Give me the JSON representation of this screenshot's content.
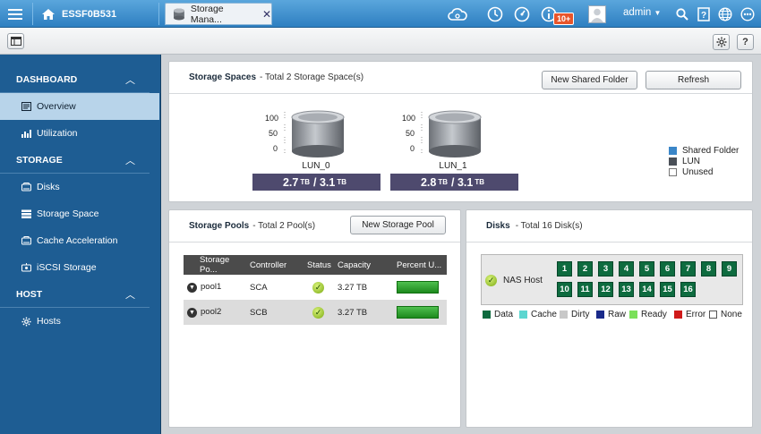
{
  "header": {
    "hostname": "ESSF0B531",
    "app_tab": "Storage Mana...",
    "notification_count": "10+",
    "user": "admin"
  },
  "sidebar": {
    "sections": [
      {
        "label": "DASHBOARD",
        "items": [
          "Overview",
          "Utilization"
        ]
      },
      {
        "label": "STORAGE",
        "items": [
          "Disks",
          "Storage Space",
          "Cache Acceleration",
          "iSCSI Storage"
        ]
      },
      {
        "label": "HOST",
        "items": [
          "Hosts"
        ]
      }
    ],
    "active_item": "Overview"
  },
  "storage_spaces": {
    "title": "Storage Spaces",
    "subtitle": "- Total 2 Storage Space(s)",
    "new_folder_label": "New Shared Folder",
    "refresh_label": "Refresh",
    "y_ticks": [
      "100",
      "50",
      "0"
    ],
    "luns": [
      {
        "name": "LUN_0",
        "used": "2.7",
        "unit1": "TB",
        "sep": "/",
        "total": "3.1",
        "unit2": "TB"
      },
      {
        "name": "LUN_1",
        "used": "2.8",
        "unit1": "TB",
        "sep": "/",
        "total": "3.1",
        "unit2": "TB"
      }
    ],
    "legend": [
      {
        "label": "Shared Folder",
        "color": "#3a86c8"
      },
      {
        "label": "LUN",
        "color": "#4a5058"
      },
      {
        "label": "Unused",
        "color": "#ffffff"
      }
    ]
  },
  "storage_pools": {
    "title": "Storage Pools",
    "subtitle": "- Total 2 Pool(s)",
    "new_pool_label": "New Storage Pool",
    "columns": [
      "Storage Po...",
      "Controller",
      "Status",
      "Capacity",
      "Percent U..."
    ],
    "rows": [
      {
        "name": "pool1",
        "controller": "SCA",
        "capacity": "3.27 TB",
        "percent_used": 1.0
      },
      {
        "name": "pool2",
        "controller": "SCB",
        "capacity": "3.27 TB",
        "percent_used": 1.0
      }
    ]
  },
  "disks": {
    "title": "Disks",
    "subtitle": "- Total 16 Disk(s)",
    "host_label": "NAS Host",
    "slots": [
      "1",
      "2",
      "3",
      "4",
      "5",
      "6",
      "7",
      "8",
      "9",
      "10",
      "11",
      "12",
      "13",
      "14",
      "15",
      "16"
    ],
    "legend": [
      {
        "label": "Data",
        "color": "#0e6b3f"
      },
      {
        "label": "Cache",
        "color": "#5cd6d0"
      },
      {
        "label": "Dirty",
        "color": "#c8c8c8"
      },
      {
        "label": "Raw",
        "color": "#1a2a8a"
      },
      {
        "label": "Ready",
        "color": "#7be05a"
      },
      {
        "label": "Error",
        "color": "#d01a1a"
      },
      {
        "label": "None",
        "color": "#ffffff"
      }
    ]
  }
}
